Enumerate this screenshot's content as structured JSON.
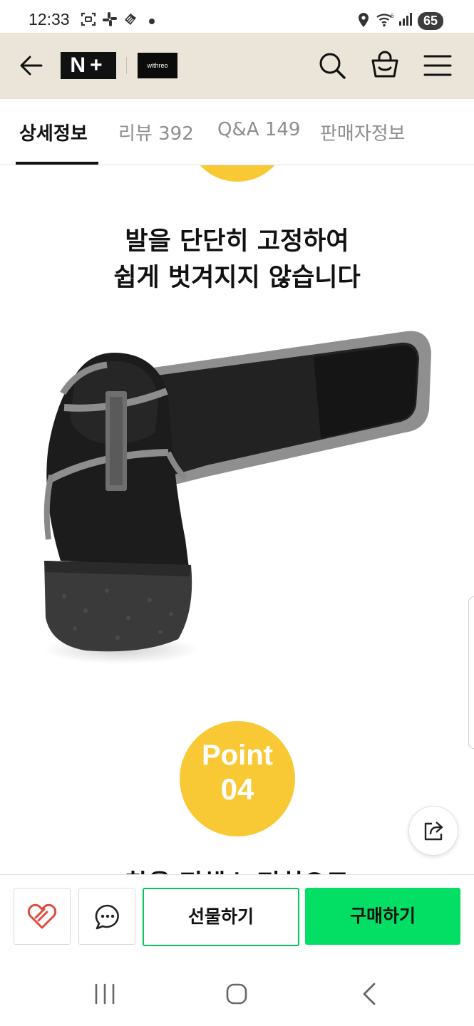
{
  "status_bar": {
    "time": "12:33",
    "battery": "65",
    "icons": [
      "screenshot-icon",
      "slack-icon",
      "app-icon",
      "dot-icon",
      "location-icon",
      "wifi-icon",
      "signal-icon",
      "battery-icon"
    ]
  },
  "header": {
    "logo": "N+",
    "brand_logo": "withreo",
    "colors": {
      "background": "#ebe4d8"
    }
  },
  "tabs": [
    {
      "label": "상세정보",
      "active": true
    },
    {
      "label": "리뷰 392",
      "active": false
    },
    {
      "label": "Q&A 149",
      "active": false
    },
    {
      "label": "판매자정보",
      "active": false
    }
  ],
  "content": {
    "headline_line1": "발을 단단히 고정하여",
    "headline_line2": "쉽게 벗겨지지 않습니다",
    "point_label": "Point",
    "point_number": "04",
    "next_headline": "착용 편해소 편히으로",
    "badge_color": "#f8c935"
  },
  "action_bar": {
    "gift_label": "선물하기",
    "buy_label": "구매하기",
    "buy_color": "#03df64"
  }
}
